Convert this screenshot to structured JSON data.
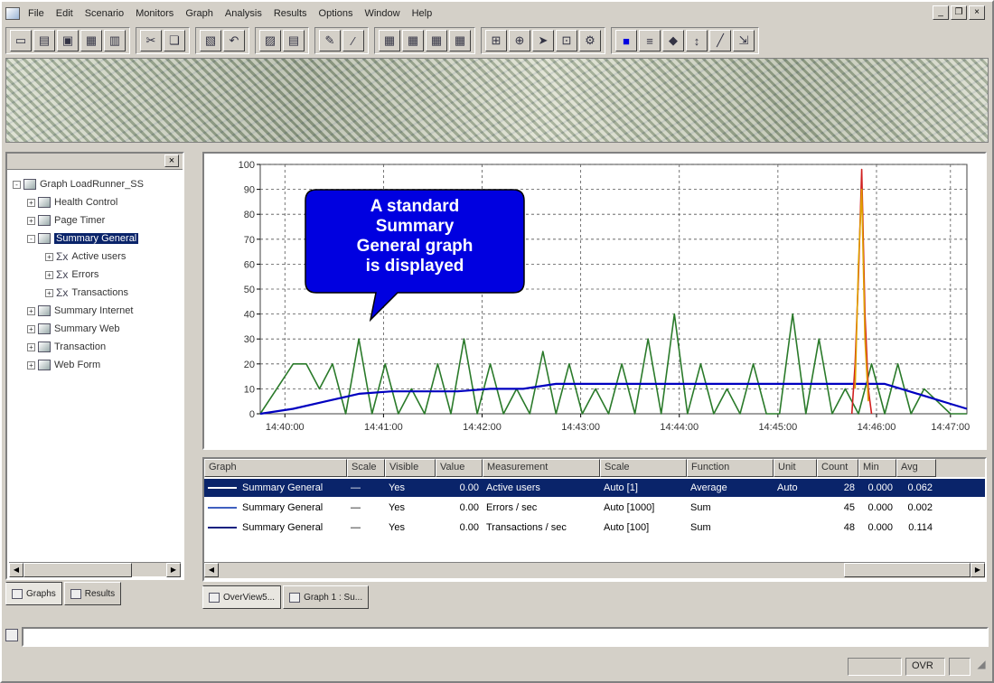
{
  "menu": {
    "items": [
      "File",
      "Edit",
      "Scenario",
      "Monitors",
      "Graph",
      "Analysis",
      "Results",
      "Options",
      "Window",
      "Help"
    ]
  },
  "window_controls": {
    "minimize": "_",
    "restore": "❐",
    "close": "×"
  },
  "toolbar": {
    "groups": [
      [
        "new-icon",
        "open-icon",
        "save-icon",
        "properties-icon",
        "print-icon"
      ],
      [
        "cut-icon",
        "copy-icon"
      ],
      [
        "paste-icon",
        "undo-icon"
      ],
      [
        "graph-icon",
        "report-icon"
      ],
      [
        "edit-icon",
        "pencil-icon"
      ],
      [
        "layout1-icon",
        "layout2-icon",
        "layout3-icon",
        "layout4-icon"
      ],
      [
        "merge-icon",
        "filter-icon",
        "arrow-icon",
        "zoom-icon",
        "settings-icon"
      ],
      [
        "color-icon",
        "line-icon",
        "marker-icon",
        "scale-icon",
        "chart-icon",
        "export-icon"
      ]
    ]
  },
  "tree": {
    "root": "Graph LoadRunner_SS",
    "items": [
      {
        "label": "Health Control",
        "level": 1,
        "toggle": "+",
        "icon": "folder-icon",
        "selected": false
      },
      {
        "label": "Page Timer",
        "level": 1,
        "toggle": "+",
        "icon": "folder-icon",
        "selected": false
      },
      {
        "label": "Summary General",
        "level": 1,
        "toggle": "-",
        "icon": "folder-icon",
        "selected": true
      },
      {
        "label": "Active users",
        "level": 2,
        "toggle": "+",
        "icon": "sigma-icon",
        "selected": false
      },
      {
        "label": "Errors",
        "level": 2,
        "toggle": "+",
        "icon": "sigma-icon",
        "selected": false
      },
      {
        "label": "Transactions",
        "level": 2,
        "toggle": "+",
        "icon": "sigma-icon",
        "selected": false
      },
      {
        "label": "Summary Internet",
        "level": 1,
        "toggle": "+",
        "icon": "folder-icon",
        "selected": false
      },
      {
        "label": "Summary Web",
        "level": 1,
        "toggle": "+",
        "icon": "folder-icon",
        "selected": false
      },
      {
        "label": "Transaction",
        "level": 1,
        "toggle": "+",
        "icon": "folder-icon",
        "selected": false
      },
      {
        "label": "Web Form",
        "level": 1,
        "toggle": "+",
        "icon": "folder-icon",
        "selected": false
      }
    ]
  },
  "left_tabs": [
    {
      "label": "Graphs",
      "active": true
    },
    {
      "label": "Results",
      "active": false
    }
  ],
  "callout": {
    "lines": [
      "A standard",
      "Summary",
      "General graph",
      "is displayed"
    ],
    "bg_color": "#0000e0"
  },
  "chart_data": {
    "type": "line",
    "ylim": [
      0,
      100
    ],
    "yticks": [
      0,
      10,
      20,
      30,
      40,
      50,
      60,
      70,
      80,
      90,
      100
    ],
    "xlim": [
      0,
      430
    ],
    "xticks": [
      {
        "pos": 15,
        "label": "14:40:00"
      },
      {
        "pos": 75,
        "label": "14:41:00"
      },
      {
        "pos": 135,
        "label": "14:42:00"
      },
      {
        "pos": 195,
        "label": "14:43:00"
      },
      {
        "pos": 255,
        "label": "14:44:00"
      },
      {
        "pos": 315,
        "label": "14:45:00"
      },
      {
        "pos": 375,
        "label": "14:46:00"
      },
      {
        "pos": 420,
        "label": "14:47:00"
      }
    ],
    "grid": true,
    "series": [
      {
        "color": "#2a7a2a",
        "x": [
          0,
          10,
          20,
          28,
          36,
          44,
          52,
          60,
          68,
          76,
          84,
          92,
          100,
          108,
          116,
          124,
          132,
          140,
          148,
          156,
          164,
          172,
          180,
          188,
          196,
          204,
          212,
          220,
          228,
          236,
          244,
          252,
          260,
          268,
          276,
          284,
          292,
          300,
          308,
          316,
          324,
          332,
          340,
          348,
          356,
          364,
          372,
          380,
          388,
          396,
          404,
          412,
          420,
          430
        ],
        "y": [
          0,
          10,
          20,
          20,
          10,
          20,
          0,
          30,
          0,
          20,
          0,
          10,
          0,
          20,
          0,
          30,
          0,
          20,
          0,
          10,
          0,
          25,
          0,
          20,
          0,
          10,
          0,
          20,
          0,
          30,
          0,
          40,
          0,
          20,
          0,
          10,
          0,
          20,
          0,
          0,
          40,
          0,
          30,
          0,
          10,
          0,
          20,
          0,
          20,
          0,
          10,
          5,
          0,
          0
        ]
      },
      {
        "color": "#0000c0",
        "x": [
          0,
          20,
          40,
          60,
          80,
          100,
          120,
          140,
          160,
          180,
          200,
          220,
          240,
          260,
          280,
          300,
          320,
          340,
          360,
          380,
          400,
          420,
          430
        ],
        "y": [
          0,
          2,
          5,
          8,
          9,
          9,
          9,
          10,
          10,
          12,
          12,
          12,
          12,
          12,
          12,
          12,
          12,
          12,
          12,
          12,
          8,
          4,
          2
        ]
      },
      {
        "color": "#d02020",
        "x": [
          360,
          362,
          364,
          366,
          368,
          370,
          372
        ],
        "y": [
          0,
          20,
          55,
          98,
          40,
          10,
          0
        ]
      },
      {
        "color": "#e0a000",
        "x": [
          362,
          364,
          366,
          368,
          370
        ],
        "y": [
          10,
          60,
          90,
          30,
          5
        ]
      }
    ]
  },
  "legend": {
    "headers": [
      "Graph",
      "Scale",
      "Visible",
      "Value",
      "Measurement",
      "Scale",
      "Function",
      "Unit",
      "Count",
      "Min",
      "Avg"
    ],
    "rows": [
      {
        "graph": "Summary General",
        "scale": "—",
        "visible": "Yes",
        "value": "0.00",
        "measurement": "Active users",
        "scale2": "Auto [1]",
        "function": "Average",
        "unit": "Auto",
        "count": "28",
        "min": "0.000",
        "avg": "0.062",
        "color": "#0a246a",
        "selected": true
      },
      {
        "graph": "Summary General",
        "scale": "—",
        "visible": "Yes",
        "value": "0.00",
        "measurement": "Errors / sec",
        "scale2": "Auto [1000]",
        "function": "Sum",
        "unit": "",
        "count": "45",
        "min": "0.000",
        "avg": "0.002",
        "color": "#4060c0",
        "selected": false
      },
      {
        "graph": "Summary General",
        "scale": "—",
        "visible": "Yes",
        "value": "0.00",
        "measurement": "Transactions / sec",
        "scale2": "Auto [100]",
        "function": "Sum",
        "unit": "",
        "count": "48",
        "min": "0.000",
        "avg": "0.114",
        "color": "#102080",
        "selected": false
      }
    ]
  },
  "graph_tabs": [
    {
      "label": "OverView5...",
      "active": true
    },
    {
      "label": "Graph 1 : Su...",
      "active": false
    }
  ],
  "statusbar": {
    "panels": [
      "",
      "",
      "OVR",
      ""
    ]
  }
}
